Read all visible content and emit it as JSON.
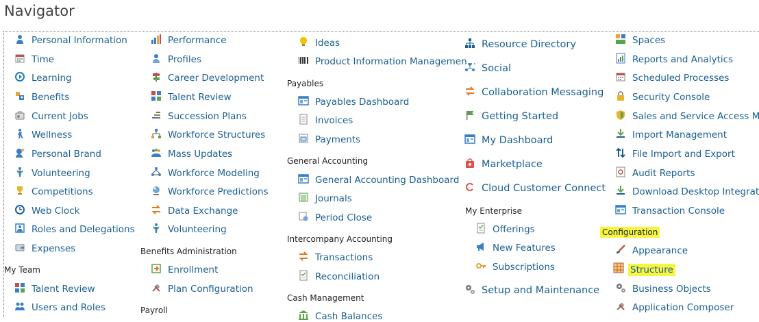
{
  "page_title": "Navigator",
  "col1": {
    "items": [
      {
        "label": "Personal Information",
        "icon": "person-icon"
      },
      {
        "label": "Time",
        "icon": "calendar-icon"
      },
      {
        "label": "Learning",
        "icon": "play-circle-icon"
      },
      {
        "label": "Benefits",
        "icon": "benefits-icon"
      },
      {
        "label": "Current Jobs",
        "icon": "briefcase-icon"
      },
      {
        "label": "Wellness",
        "icon": "walking-person-icon"
      },
      {
        "label": "Personal Brand",
        "icon": "person-brand-icon"
      },
      {
        "label": "Volunteering",
        "icon": "volunteer-icon"
      },
      {
        "label": "Competitions",
        "icon": "trophy-icon"
      },
      {
        "label": "Web Clock",
        "icon": "clock-icon"
      },
      {
        "label": "Roles and Delegations",
        "icon": "roles-icon"
      },
      {
        "label": "Expenses",
        "icon": "wallet-icon"
      }
    ],
    "my_team_header": "My Team",
    "my_team_items": [
      {
        "label": "Talent Review",
        "icon": "grid-icon"
      },
      {
        "label": "Users and Roles",
        "icon": "users-icon"
      }
    ]
  },
  "col2": {
    "items": [
      {
        "label": "Performance",
        "icon": "bar-chart-icon"
      },
      {
        "label": "Profiles",
        "icon": "profile-icon"
      },
      {
        "label": "Career Development",
        "icon": "signpost-icon"
      },
      {
        "label": "Talent Review",
        "icon": "grid-icon"
      },
      {
        "label": "Succession Plans",
        "icon": "stairs-icon"
      },
      {
        "label": "Workforce Structures",
        "icon": "org-icon"
      },
      {
        "label": "Mass Updates",
        "icon": "group-icon"
      },
      {
        "label": "Workforce Modeling",
        "icon": "network-icon"
      },
      {
        "label": "Workforce Predictions",
        "icon": "crystal-ball-icon"
      },
      {
        "label": "Data Exchange",
        "icon": "exchange-icon"
      },
      {
        "label": "Volunteering",
        "icon": "volunteer-icon"
      }
    ],
    "benefits_header": "Benefits Administration",
    "benefits_items": [
      {
        "label": "Enrollment",
        "icon": "enrollment-icon"
      },
      {
        "label": "Plan Configuration",
        "icon": "tools-icon"
      }
    ],
    "payroll_header": "Payroll"
  },
  "col3": {
    "items": [
      {
        "label": "Ideas",
        "icon": "lightbulb-icon"
      },
      {
        "label": "Product Information Managemen…",
        "icon": "barcode-icon"
      }
    ],
    "payables_header": "Payables",
    "payables_items": [
      {
        "label": "Payables Dashboard",
        "icon": "dashboard-icon"
      },
      {
        "label": "Invoices",
        "icon": "document-icon"
      },
      {
        "label": "Payments",
        "icon": "payment-icon"
      }
    ],
    "ga_header": "General Accounting",
    "ga_items": [
      {
        "label": "General Accounting Dashboard",
        "icon": "dashboard-icon"
      },
      {
        "label": "Journals",
        "icon": "journal-icon"
      },
      {
        "label": "Period Close",
        "icon": "period-close-icon"
      }
    ],
    "ic_header": "Intercompany Accounting",
    "ic_items": [
      {
        "label": "Transactions",
        "icon": "exchange-icon"
      },
      {
        "label": "Reconciliation",
        "icon": "checklist-icon"
      }
    ],
    "cash_header": "Cash Management",
    "cash_items": [
      {
        "label": "Cash Balances",
        "icon": "bank-icon"
      }
    ]
  },
  "col4": {
    "items": [
      {
        "label": "Resource Directory",
        "icon": "hierarchy-icon"
      },
      {
        "label": "Social",
        "icon": "social-icon"
      },
      {
        "label": "Collaboration Messaging",
        "icon": "exchange-icon"
      },
      {
        "label": "Getting Started",
        "icon": "flag-icon"
      },
      {
        "label": "My Dashboard",
        "icon": "dashboard-icon"
      },
      {
        "label": "Marketplace",
        "icon": "bag-icon"
      },
      {
        "label": "Cloud Customer Connect",
        "icon": "connect-icon"
      }
    ],
    "enterprise_header": "My Enterprise",
    "enterprise_items": [
      {
        "label": "Offerings",
        "icon": "checklist-icon"
      },
      {
        "label": "New Features",
        "icon": "megaphone-icon"
      },
      {
        "label": "Subscriptions",
        "icon": "key-icon"
      }
    ],
    "after_items": [
      {
        "label": "Setup and Maintenance",
        "icon": "gears-icon"
      }
    ]
  },
  "col5": {
    "items": [
      {
        "label": "Spaces",
        "icon": "spaces-icon"
      },
      {
        "label": "Reports and Analytics",
        "icon": "report-icon"
      },
      {
        "label": "Scheduled Processes",
        "icon": "calendar-icon"
      },
      {
        "label": "Security Console",
        "icon": "lock-icon"
      },
      {
        "label": "Sales and Service Access Mana…",
        "icon": "shield-icon"
      },
      {
        "label": "Import Management",
        "icon": "download-icon"
      },
      {
        "label": "File Import and Export",
        "icon": "updown-arrows-icon"
      },
      {
        "label": "Audit Reports",
        "icon": "audit-icon"
      },
      {
        "label": "Download Desktop Integration …",
        "icon": "download-icon"
      },
      {
        "label": "Transaction Console",
        "icon": "dashboard-icon"
      }
    ],
    "config_header": "Configuration",
    "config_items": [
      {
        "label": "Appearance",
        "icon": "brush-icon"
      },
      {
        "label": "Structure",
        "icon": "structure-icon"
      },
      {
        "label": "Business Objects",
        "icon": "gears-icon"
      },
      {
        "label": "Application Composer",
        "icon": "tools-icon"
      }
    ]
  },
  "highlight_color": "#f5f542",
  "link_color": "#1a5f92"
}
